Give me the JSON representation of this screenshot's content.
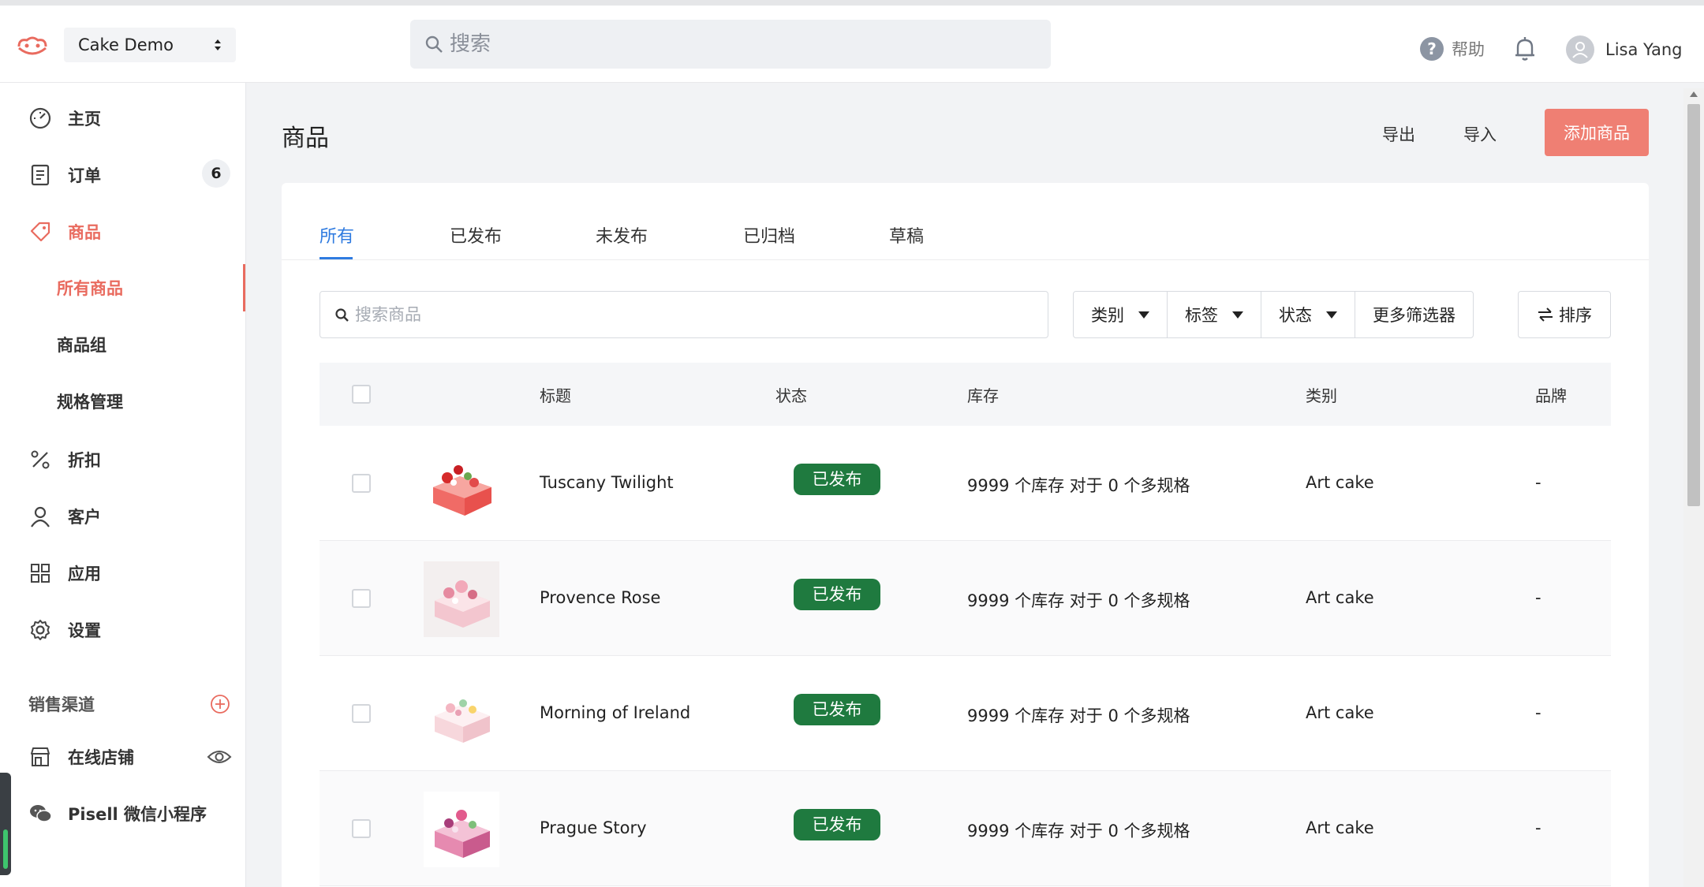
{
  "header": {
    "store_name": "Cake Demo",
    "search_placeholder": "搜索",
    "help_label": "帮助",
    "user_name": "Lisa Yang"
  },
  "sidebar": {
    "home": "主页",
    "orders": "订单",
    "orders_badge": "6",
    "products": "商品",
    "sub_all_products": "所有商品",
    "sub_product_groups": "商品组",
    "sub_variants": "规格管理",
    "discounts": "折扣",
    "customers": "客户",
    "apps": "应用",
    "settings": "设置",
    "channels_title": "销售渠道",
    "online_store": "在线店铺",
    "mini_program": "Pisell 微信小程序"
  },
  "page": {
    "title": "商品",
    "export_label": "导出",
    "import_label": "导入",
    "add_product_label": "添加商品"
  },
  "tabs": [
    "所有",
    "已发布",
    "未发布",
    "已归档",
    "草稿"
  ],
  "filters": {
    "search_placeholder": "搜索商品",
    "category": "类别",
    "tags": "标签",
    "status": "状态",
    "more": "更多筛选器",
    "sort": "排序"
  },
  "table": {
    "headers": [
      "标题",
      "状态",
      "库存",
      "类别",
      "品牌"
    ],
    "rows": [
      {
        "title": "Tuscany Twilight",
        "status": "已发布",
        "stock": "9999 个库存 对于 0 个多规格",
        "category": "Art cake",
        "brand": "-"
      },
      {
        "title": "Provence Rose",
        "status": "已发布",
        "stock": "9999 个库存 对于 0 个多规格",
        "category": "Art cake",
        "brand": "-"
      },
      {
        "title": "Morning of Ireland",
        "status": "已发布",
        "stock": "9999 个库存 对于 0 个多规格",
        "category": "Art cake",
        "brand": "-"
      },
      {
        "title": "Prague Story",
        "status": "已发布",
        "stock": "9999 个库存 对于 0 个多规格",
        "category": "Art cake",
        "brand": "-"
      }
    ]
  },
  "colors": {
    "accent": "#e96b5f",
    "primary_button": "#ef7f73",
    "tab_active": "#2f7be0",
    "status_published": "#1f7a3f"
  }
}
